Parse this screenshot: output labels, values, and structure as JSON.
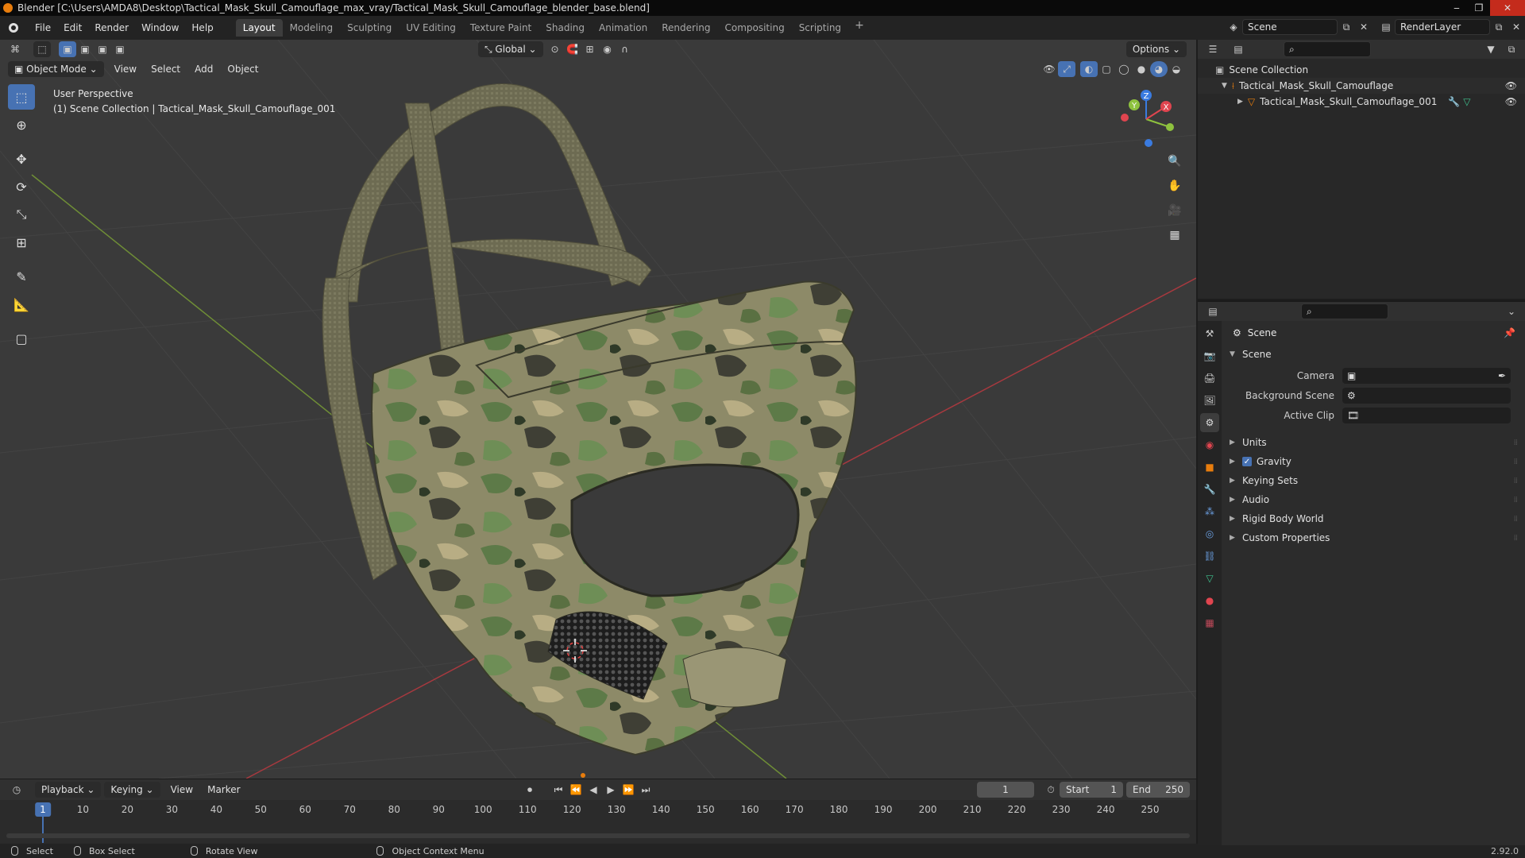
{
  "window": {
    "title": "Blender [C:\\Users\\AMDA8\\Desktop\\Tactical_Mask_Skull_Camouflage_max_vray/Tactical_Mask_Skull_Camouflage_blender_base.blend]",
    "controls": [
      "‒",
      "❐",
      "✕"
    ]
  },
  "menu": {
    "items": [
      "File",
      "Edit",
      "Render",
      "Window",
      "Help"
    ],
    "workspaces": [
      "Layout",
      "Modeling",
      "Sculpting",
      "UV Editing",
      "Texture Paint",
      "Shading",
      "Animation",
      "Rendering",
      "Compositing",
      "Scripting"
    ],
    "active_workspace": "Layout",
    "plus": "+",
    "scene_name": "Scene",
    "render_layer": "RenderLayer"
  },
  "viewport": {
    "transform_orientation": "Global",
    "options_label": "Options",
    "mode": "Object Mode",
    "header_menus": [
      "View",
      "Select",
      "Add",
      "Object"
    ],
    "overlay_line1": "User Perspective",
    "overlay_line2": "(1) Scene Collection | Tactical_Mask_Skull_Camouflage_001",
    "gizmo": {
      "x": "X",
      "y": "Y",
      "z": "Z"
    }
  },
  "timeline": {
    "menus": [
      "Playback",
      "Keying",
      "View",
      "Marker"
    ],
    "current_frame": "1",
    "start_label": "Start",
    "start_value": "1",
    "end_label": "End",
    "end_value": "250",
    "ticks": [
      "1",
      "10",
      "20",
      "30",
      "40",
      "50",
      "60",
      "70",
      "80",
      "90",
      "100",
      "110",
      "120",
      "130",
      "140",
      "150",
      "160",
      "170",
      "180",
      "190",
      "200",
      "210",
      "220",
      "230",
      "240",
      "250"
    ],
    "playhead": "1"
  },
  "statusbar": {
    "select": "Select",
    "box_select": "Box Select",
    "rotate": "Rotate View",
    "context_menu": "Object Context Menu",
    "version": "2.92.0"
  },
  "outliner": {
    "root": "Scene Collection",
    "collection": "Tactical_Mask_Skull_Camouflage",
    "object": "Tactical_Mask_Skull_Camouflage_001"
  },
  "properties": {
    "context_title": "Scene",
    "panel_scene": "Scene",
    "camera_label": "Camera",
    "background_label": "Background Scene",
    "clip_label": "Active Clip",
    "panels": [
      "Units",
      "Gravity",
      "Keying Sets",
      "Audio",
      "Rigid Body World",
      "Custom Properties"
    ],
    "gravity_checked": true
  },
  "colors": {
    "accent": "#4772b3",
    "orange": "#e87d0d",
    "axis_x": "#e0454f",
    "axis_y": "#8ec23e",
    "axis_z": "#3a7be0",
    "viewport_bg": "#3a3a3a"
  }
}
